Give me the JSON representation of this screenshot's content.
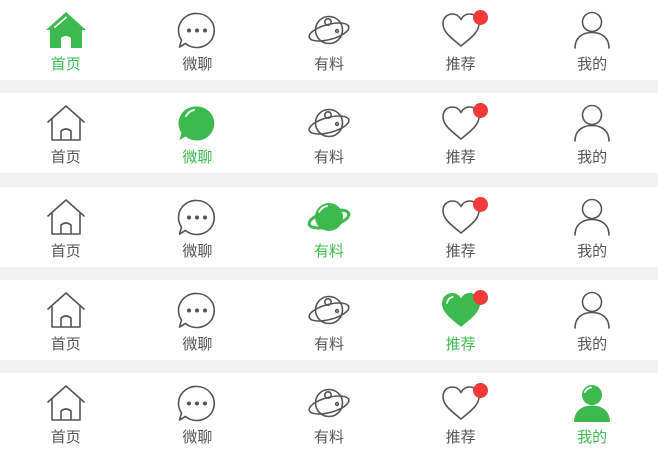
{
  "colors": {
    "active": "#3dba4e",
    "inactive": "#555555",
    "badge": "#f23a3a",
    "bar_background": "#ffffff",
    "separator": "#f1f1f1"
  },
  "tabbars": [
    {
      "active": "home",
      "tabs": [
        {
          "id": "home",
          "label": "首页",
          "icon": "home-icon",
          "active": true
        },
        {
          "id": "chat",
          "label": "微聊",
          "icon": "chat-bubble-icon",
          "active": false
        },
        {
          "id": "discover",
          "label": "有料",
          "icon": "planet-icon",
          "active": false
        },
        {
          "id": "recommend",
          "label": "推荐",
          "icon": "heart-icon",
          "active": false,
          "badge": true
        },
        {
          "id": "me",
          "label": "我的",
          "icon": "user-icon",
          "active": false
        }
      ]
    },
    {
      "active": "chat",
      "tabs": [
        {
          "id": "home",
          "label": "首页",
          "icon": "home-icon",
          "active": false
        },
        {
          "id": "chat",
          "label": "微聊",
          "icon": "chat-bubble-icon",
          "active": true
        },
        {
          "id": "discover",
          "label": "有料",
          "icon": "planet-icon",
          "active": false
        },
        {
          "id": "recommend",
          "label": "推荐",
          "icon": "heart-icon",
          "active": false,
          "badge": true
        },
        {
          "id": "me",
          "label": "我的",
          "icon": "user-icon",
          "active": false
        }
      ]
    },
    {
      "active": "discover",
      "tabs": [
        {
          "id": "home",
          "label": "首页",
          "icon": "home-icon",
          "active": false
        },
        {
          "id": "chat",
          "label": "微聊",
          "icon": "chat-bubble-icon",
          "active": false
        },
        {
          "id": "discover",
          "label": "有料",
          "icon": "planet-icon",
          "active": true
        },
        {
          "id": "recommend",
          "label": "推荐",
          "icon": "heart-icon",
          "active": false,
          "badge": true
        },
        {
          "id": "me",
          "label": "我的",
          "icon": "user-icon",
          "active": false
        }
      ]
    },
    {
      "active": "recommend",
      "tabs": [
        {
          "id": "home",
          "label": "首页",
          "icon": "home-icon",
          "active": false
        },
        {
          "id": "chat",
          "label": "微聊",
          "icon": "chat-bubble-icon",
          "active": false
        },
        {
          "id": "discover",
          "label": "有料",
          "icon": "planet-icon",
          "active": false
        },
        {
          "id": "recommend",
          "label": "推荐",
          "icon": "heart-icon",
          "active": true,
          "badge": true
        },
        {
          "id": "me",
          "label": "我的",
          "icon": "user-icon",
          "active": false
        }
      ]
    },
    {
      "active": "me",
      "tabs": [
        {
          "id": "home",
          "label": "首页",
          "icon": "home-icon",
          "active": false
        },
        {
          "id": "chat",
          "label": "微聊",
          "icon": "chat-bubble-icon",
          "active": false
        },
        {
          "id": "discover",
          "label": "有料",
          "icon": "planet-icon",
          "active": false
        },
        {
          "id": "recommend",
          "label": "推荐",
          "icon": "heart-icon",
          "active": false,
          "badge": true
        },
        {
          "id": "me",
          "label": "我的",
          "icon": "user-icon",
          "active": true
        }
      ]
    }
  ]
}
